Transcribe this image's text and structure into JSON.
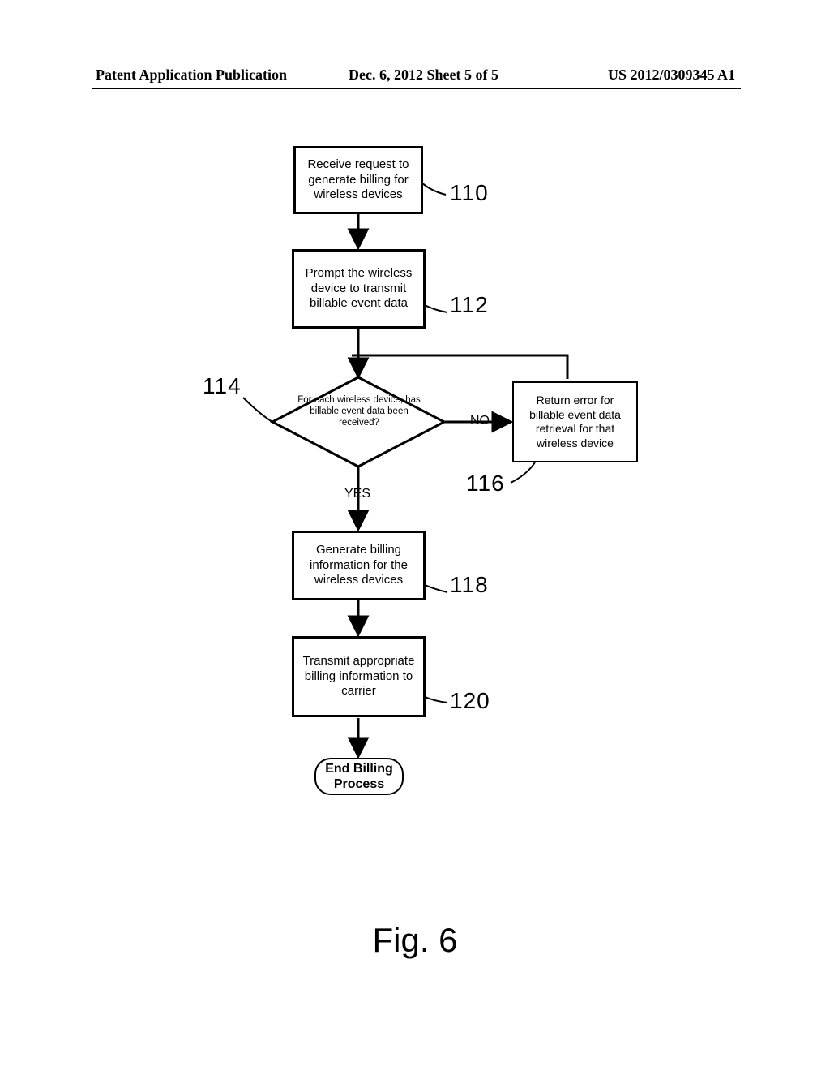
{
  "header": {
    "left": "Patent Application Publication",
    "center": "Dec. 6, 2012  Sheet 5 of 5",
    "right": "US 2012/0309345 A1"
  },
  "flow": {
    "b110": {
      "text": "Receive request to generate billing for wireless devices",
      "ref": "110"
    },
    "b112": {
      "text": "Prompt the wireless device to transmit billable event data",
      "ref": "112"
    },
    "d114": {
      "text": "For each wireless device, has billable event data been received?",
      "ref": "114",
      "no": "NO",
      "yes": "YES"
    },
    "b116": {
      "text": "Return error for billable event data retrieval for that wireless device",
      "ref": "116"
    },
    "b118": {
      "text": "Generate billing information for the wireless devices",
      "ref": "118"
    },
    "b120": {
      "text": "Transmit appropriate billing information to carrier",
      "ref": "120"
    },
    "term": {
      "text": "End Billing Process"
    }
  },
  "figure": {
    "caption": "Fig. 6"
  }
}
